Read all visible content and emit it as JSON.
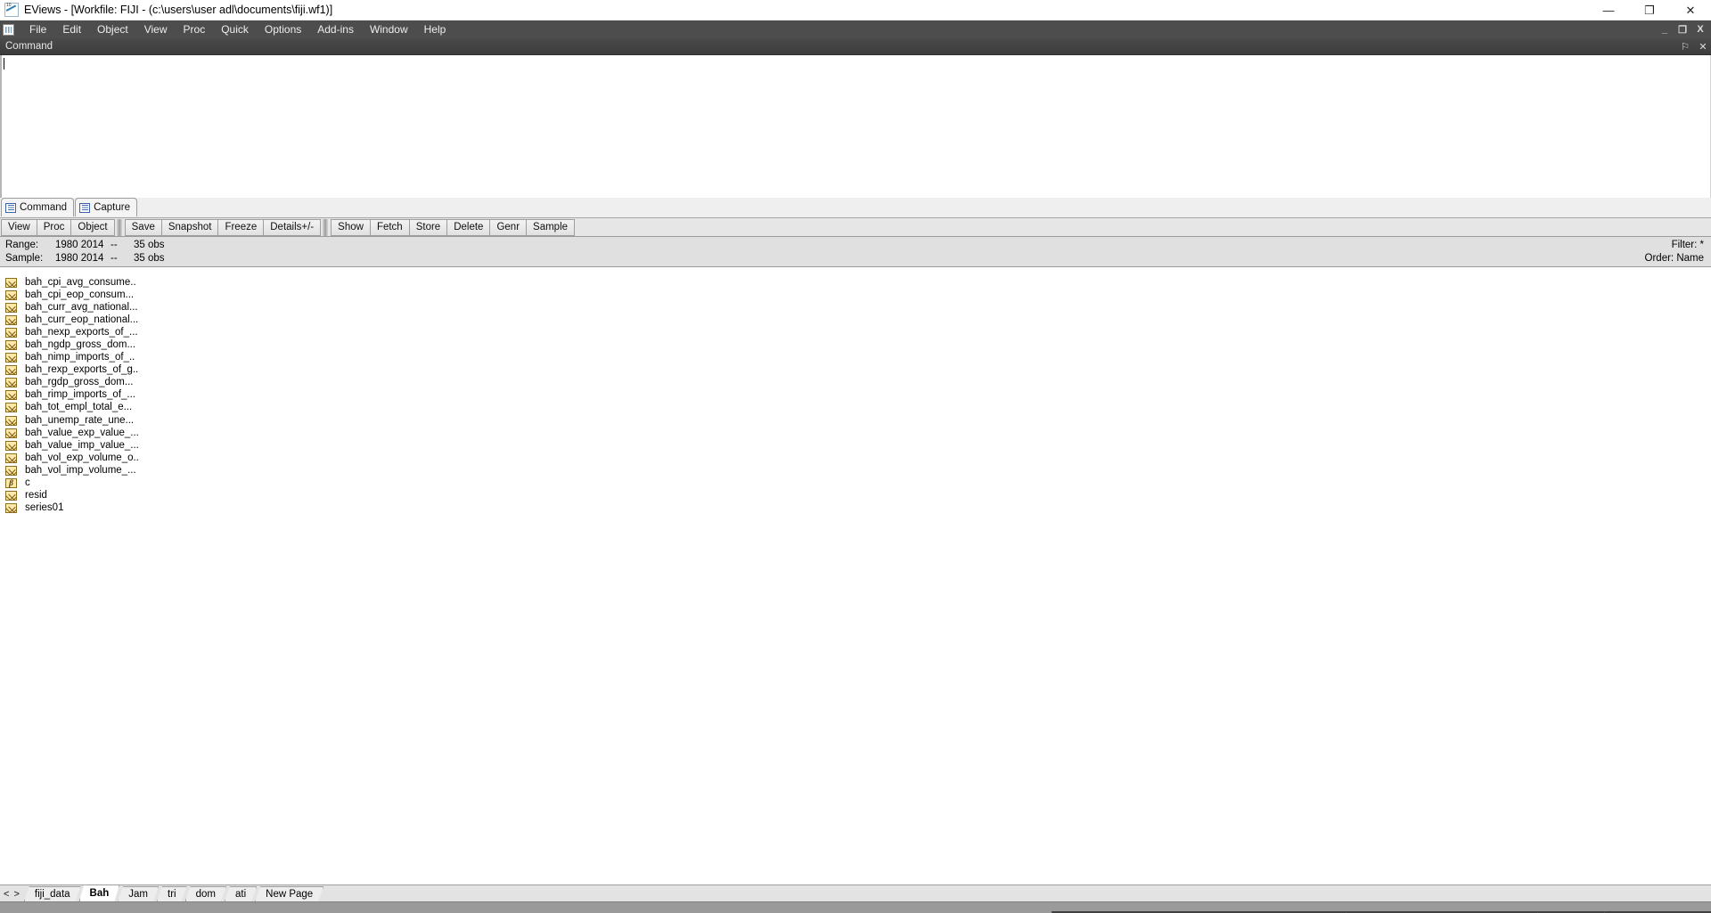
{
  "window": {
    "title": "EViews - [Workfile: FIJI - (c:\\users\\user adl\\documents\\fiji.wf1)]",
    "app_icon": "eviews-logo-icon",
    "minimize_label": "—",
    "maximize_label": "❐",
    "close_label": "✕"
  },
  "menubar": {
    "system_icon": "workfile-grid-icon",
    "items": [
      {
        "label": "File"
      },
      {
        "label": "Edit"
      },
      {
        "label": "Object"
      },
      {
        "label": "View"
      },
      {
        "label": "Proc"
      },
      {
        "label": "Quick"
      },
      {
        "label": "Options"
      },
      {
        "label": "Add-ins"
      },
      {
        "label": "Window"
      },
      {
        "label": "Help"
      }
    ],
    "mdi_controls": {
      "minimize": "_",
      "restore": "❐",
      "close": "X"
    }
  },
  "command_panel": {
    "header_title": "Command",
    "pin_label": "⚐",
    "close_label": "✕",
    "input_value": "",
    "tabs": [
      {
        "label": "Command",
        "icon": "document-lines-icon",
        "active": true
      },
      {
        "label": "Capture",
        "icon": "document-lines-icon",
        "active": false
      }
    ]
  },
  "workfile_toolbar": {
    "group1": [
      {
        "label": "View"
      },
      {
        "label": "Proc"
      },
      {
        "label": "Object"
      }
    ],
    "group2": [
      {
        "label": "Save"
      },
      {
        "label": "Snapshot"
      },
      {
        "label": "Freeze"
      },
      {
        "label": "Details+/-"
      }
    ],
    "group3": [
      {
        "label": "Show"
      },
      {
        "label": "Fetch"
      },
      {
        "label": "Store"
      },
      {
        "label": "Delete"
      },
      {
        "label": "Genr"
      },
      {
        "label": "Sample"
      }
    ]
  },
  "workfile_info": {
    "range_label": "Range:",
    "range_years": "1980 2014",
    "range_dash": "--",
    "range_obs": "35 obs",
    "sample_label": "Sample:",
    "sample_years": "1980 2014",
    "sample_dash": "--",
    "sample_obs": "35 obs",
    "filter": "Filter: *",
    "order": "Order: Name"
  },
  "object_list": [
    {
      "name": "bah_cpi_avg_consume..",
      "icon": "series-icon"
    },
    {
      "name": "bah_cpi_eop_consum...",
      "icon": "series-icon"
    },
    {
      "name": "bah_curr_avg_national...",
      "icon": "series-icon"
    },
    {
      "name": "bah_curr_eop_national...",
      "icon": "series-icon"
    },
    {
      "name": "bah_nexp_exports_of_...",
      "icon": "series-icon"
    },
    {
      "name": "bah_ngdp_gross_dom...",
      "icon": "series-icon"
    },
    {
      "name": "bah_nimp_imports_of_..",
      "icon": "series-icon"
    },
    {
      "name": "bah_rexp_exports_of_g..",
      "icon": "series-icon"
    },
    {
      "name": "bah_rgdp_gross_dom...",
      "icon": "series-icon"
    },
    {
      "name": "bah_rimp_imports_of_...",
      "icon": "series-icon"
    },
    {
      "name": "bah_tot_empl_total_e...",
      "icon": "series-icon"
    },
    {
      "name": "bah_unemp_rate_une...",
      "icon": "series-icon"
    },
    {
      "name": "bah_value_exp_value_...",
      "icon": "series-icon"
    },
    {
      "name": "bah_value_imp_value_...",
      "icon": "series-icon"
    },
    {
      "name": "bah_vol_exp_volume_o..",
      "icon": "series-icon"
    },
    {
      "name": "bah_vol_imp_volume_...",
      "icon": "series-icon"
    },
    {
      "name": "c",
      "icon": "coefficient-icon"
    },
    {
      "name": "resid",
      "icon": "series-icon"
    },
    {
      "name": "series01",
      "icon": "series-icon"
    }
  ],
  "page_tabs": {
    "nav_label": "< >",
    "tabs": [
      {
        "label": "fiji_data",
        "active": false
      },
      {
        "label": "Bah",
        "active": true
      },
      {
        "label": "Jam",
        "active": false
      },
      {
        "label": "tri",
        "active": false
      },
      {
        "label": "dom",
        "active": false
      },
      {
        "label": "ati",
        "active": false
      },
      {
        "label": "New Page",
        "active": false
      }
    ]
  },
  "colors": {
    "menubar_bg": "#4d4d4d",
    "toolbar_bg": "#e6e6e6",
    "info_bg": "#e0e0e0",
    "series_icon": "#ffe9a8",
    "statusbar_bg": "#9a9a9a"
  }
}
